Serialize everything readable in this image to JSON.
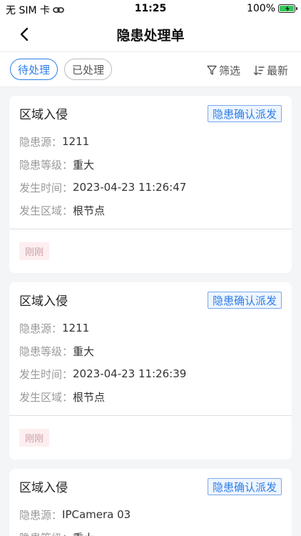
{
  "status_bar": {
    "carrier": "无 SIM 卡",
    "time": "11:25",
    "battery_percent": "100%"
  },
  "nav": {
    "title": "隐患处理单"
  },
  "tabs": [
    {
      "label": "待处理",
      "active": true
    },
    {
      "label": "已处理",
      "active": false
    }
  ],
  "actions": {
    "filter_label": "筛选",
    "sort_label": "最新"
  },
  "labels": {
    "source": "隐患源：",
    "level": "隐患等级：",
    "time": "发生时间：",
    "area": "发生区域："
  },
  "cards": [
    {
      "title": "区域入侵",
      "button": "隐患确认派发",
      "source": "1211",
      "level": "重大",
      "time": "2023-04-23 11:26:47",
      "area": "根节点",
      "tag": "刚刚"
    },
    {
      "title": "区域入侵",
      "button": "隐患确认派发",
      "source": "1211",
      "level": "重大",
      "time": "2023-04-23 11:26:39",
      "area": "根节点",
      "tag": "刚刚"
    },
    {
      "title": "区域入侵",
      "button": "隐患确认派发",
      "source": "IPCamera 03",
      "level": "重大"
    }
  ],
  "colors": {
    "accent": "#2d7ee8",
    "battery": "#34c759",
    "tag_bg": "#fdeef0"
  }
}
